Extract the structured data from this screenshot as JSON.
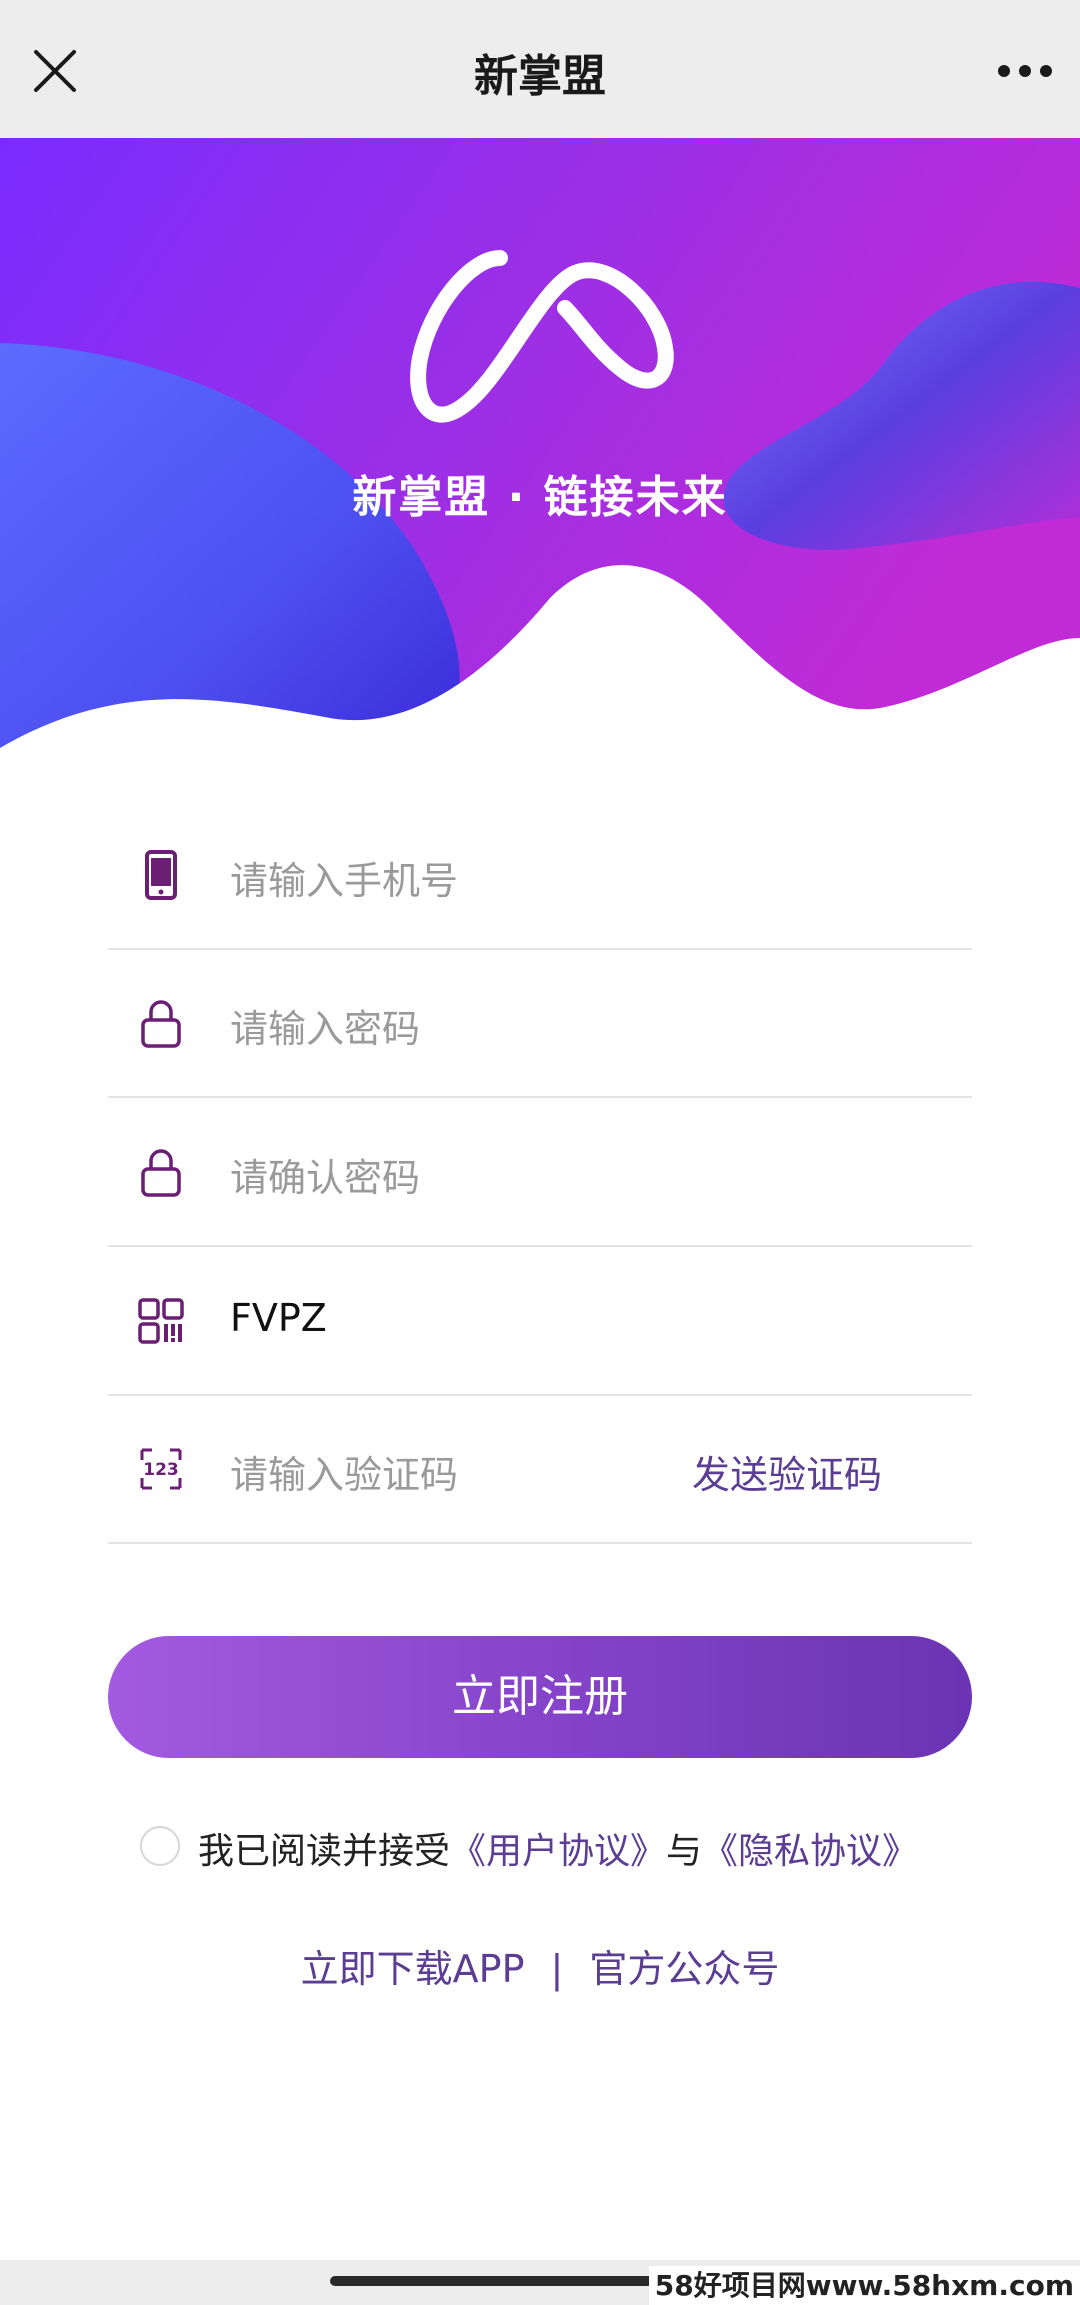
{
  "header": {
    "title": "新掌盟",
    "close_icon": "close-icon",
    "more_icon": "more-icon"
  },
  "hero": {
    "slogan": "新掌盟 · 链接未来",
    "logo_icon": "infinity-logo-icon"
  },
  "form": {
    "phone": {
      "placeholder": "请输入手机号",
      "icon": "phone-icon"
    },
    "password": {
      "placeholder": "请输入密码",
      "icon": "lock-icon"
    },
    "confirm_password": {
      "placeholder": "请确认密码",
      "icon": "lock-icon"
    },
    "invite_code": {
      "value": "FVPZ",
      "icon": "qr-code-icon"
    },
    "verify_code": {
      "placeholder": "请输入验证码",
      "icon": "number-123-icon",
      "send_label": "发送验证码"
    }
  },
  "register_button": "立即注册",
  "agreement": {
    "prefix": "我已阅读并接受",
    "user_agreement": "《用户协议》",
    "connector": "与",
    "privacy_policy": "《隐私协议》"
  },
  "footer_links": {
    "download": "立即下载APP",
    "separator": "|",
    "official": "官方公众号"
  },
  "watermark": "58好项目网www.58hxm.com",
  "colors": {
    "accent": "#5b3d93",
    "button_start": "#a35ae0",
    "button_end": "#6b34b4",
    "hero_start": "#7a2cff",
    "hero_end": "#c02bd6"
  }
}
